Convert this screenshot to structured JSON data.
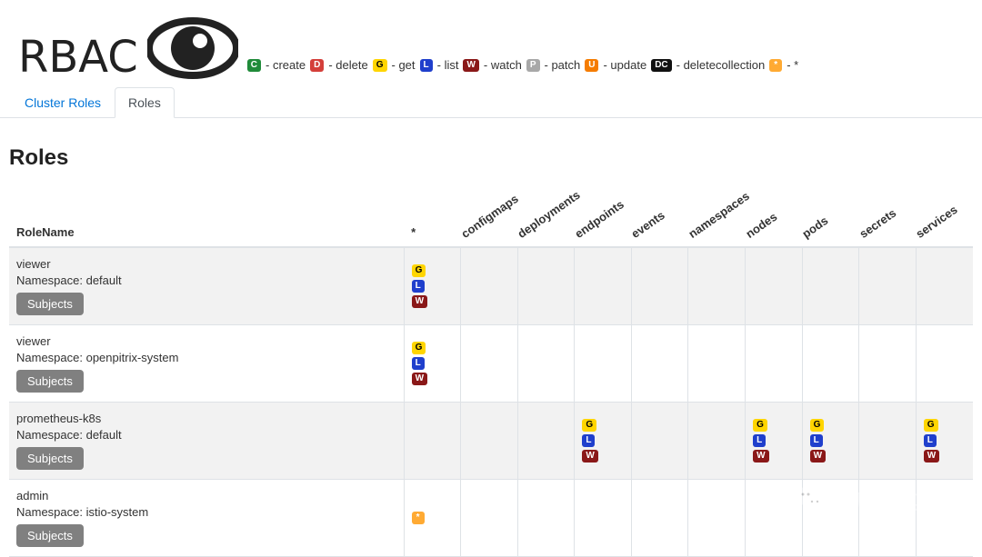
{
  "logo_text": "RBAC",
  "legend": [
    {
      "code": "C",
      "label": "create",
      "badgeClass": "badge-C"
    },
    {
      "code": "D",
      "label": "delete",
      "badgeClass": "badge-D"
    },
    {
      "code": "G",
      "label": "get",
      "badgeClass": "badge-G"
    },
    {
      "code": "L",
      "label": "list",
      "badgeClass": "badge-L"
    },
    {
      "code": "W",
      "label": "watch",
      "badgeClass": "badge-W"
    },
    {
      "code": "P",
      "label": "patch",
      "badgeClass": "badge-P"
    },
    {
      "code": "U",
      "label": "update",
      "badgeClass": "badge-U"
    },
    {
      "code": "DC",
      "label": "deletecollection",
      "badgeClass": "badge-DC"
    },
    {
      "code": "*",
      "label": "*",
      "badgeClass": "badge-star"
    }
  ],
  "tabs": {
    "cluster_roles": "Cluster Roles",
    "roles": "Roles",
    "active": "Roles"
  },
  "title": "Roles",
  "column_rolename": "RoleName",
  "namespace_label": "Namespace: ",
  "subjects_label": "Subjects",
  "columns": [
    "*",
    "configmaps",
    "deployments",
    "endpoints",
    "events",
    "namespaces",
    "nodes",
    "pods",
    "secrets",
    "services"
  ],
  "rows": [
    {
      "name": "viewer",
      "namespace": "default",
      "perms": {
        "*": [
          "G",
          "L",
          "W"
        ]
      }
    },
    {
      "name": "viewer",
      "namespace": "openpitrix-system",
      "perms": {
        "*": [
          "G",
          "L",
          "W"
        ]
      }
    },
    {
      "name": "prometheus-k8s",
      "namespace": "default",
      "perms": {
        "endpoints": [
          "G",
          "L",
          "W"
        ],
        "nodes": [
          "G",
          "L",
          "W"
        ],
        "pods": [
          "G",
          "L",
          "W"
        ],
        "services": [
          "G",
          "L",
          "W"
        ]
      }
    },
    {
      "name": "admin",
      "namespace": "istio-system",
      "perms": {
        "*": [
          "*"
        ]
      }
    }
  ],
  "watermark_text": "云原生实验室"
}
